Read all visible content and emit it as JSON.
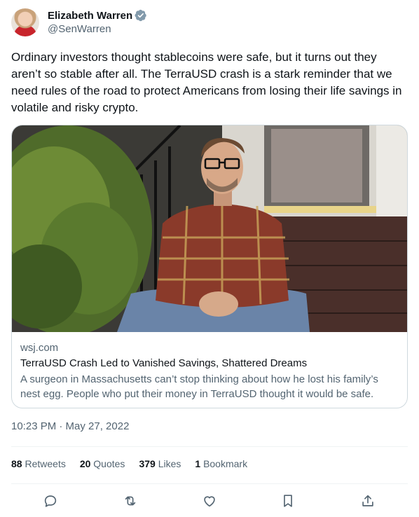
{
  "author": {
    "display_name": "Elizabeth Warren",
    "handle": "@SenWarren",
    "verified_icon": "verified-badge-icon",
    "verified_color": "#829aab"
  },
  "tweet": {
    "text": "Ordinary investors thought stablecoins were safe, but it turns out they aren’t so stable after all. The TerraUSD crash is a stark reminder that we need rules of the road to protect Americans from losing their life savings in volatile and risky crypto.",
    "timestamp": "10:23 PM · May 27, 2022"
  },
  "card": {
    "domain": "wsj.com",
    "title": "TerraUSD Crash Led to Vanished Savings, Shattered Dreams",
    "description": "A surgeon in Massachusetts can’t stop thinking about how he lost his family’s nest egg. People who put their money in TerraUSD thought it would be safe."
  },
  "stats": {
    "retweets_count": "88",
    "retweets_label": "Retweets",
    "quotes_count": "20",
    "quotes_label": "Quotes",
    "likes_count": "379",
    "likes_label": "Likes",
    "bookmarks_count": "1",
    "bookmarks_label": "Bookmark"
  },
  "actions": {
    "icons": [
      "reply-icon",
      "retweet-icon",
      "like-icon",
      "bookmark-icon",
      "share-icon"
    ],
    "icon_color": "#536471"
  },
  "colors": {
    "text_primary": "#0f1419",
    "text_secondary": "#536471",
    "border": "#cfd9de"
  }
}
